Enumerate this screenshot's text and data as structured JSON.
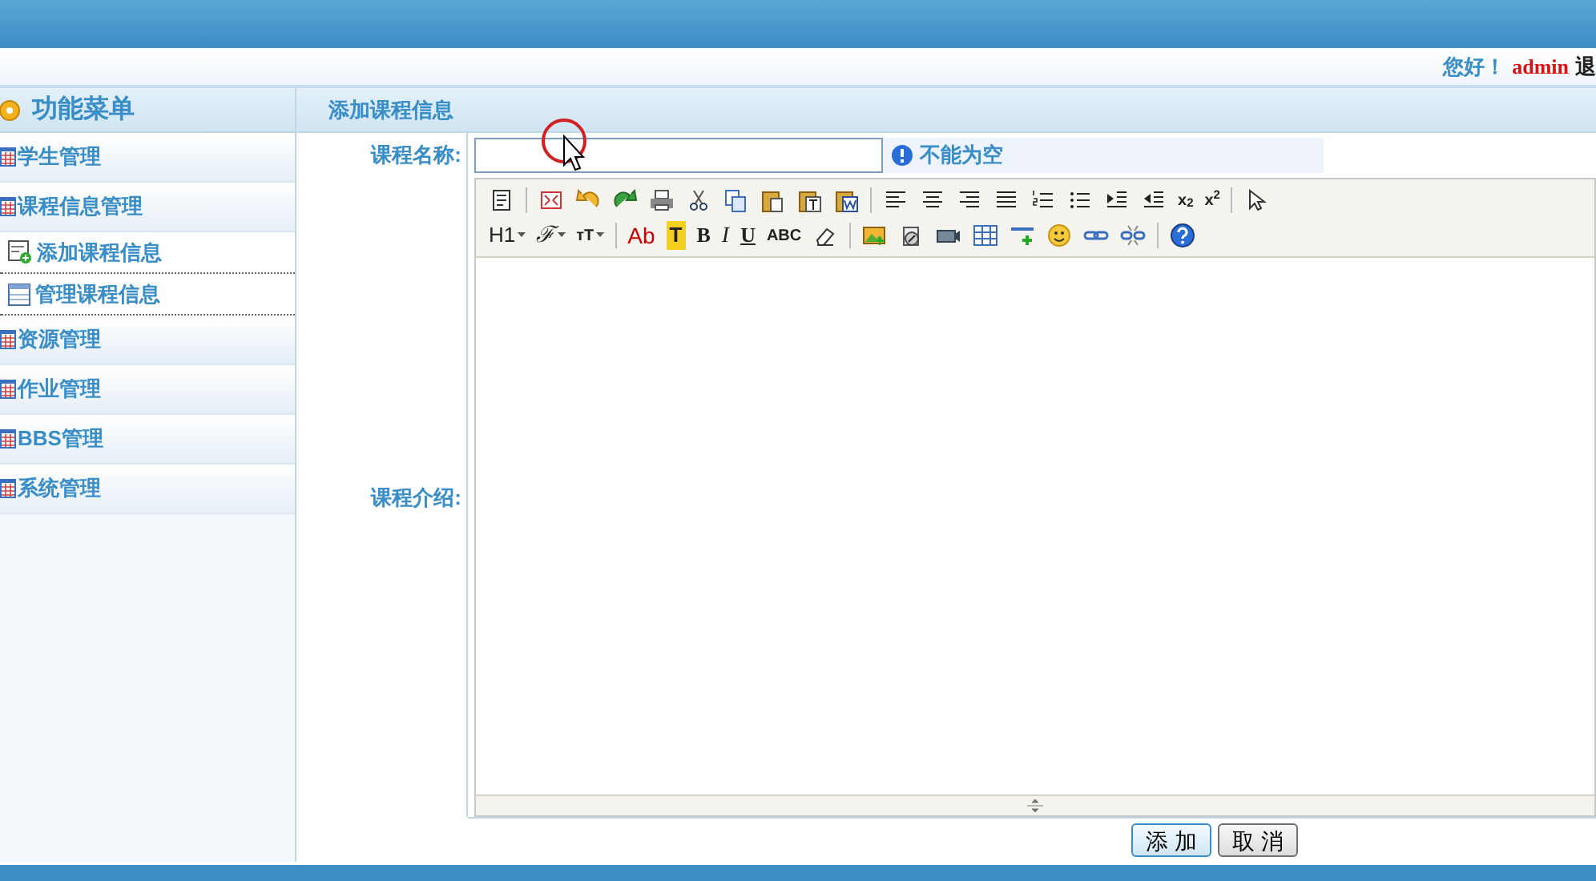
{
  "header": {
    "greeting": "您好！",
    "user": "admin",
    "logout": "退"
  },
  "menu": {
    "title": "功能菜单",
    "groups": [
      {
        "label": "学生管理"
      },
      {
        "label": "课程信息管理",
        "children": [
          {
            "label": "添加课程信息"
          },
          {
            "label": "管理课程信息"
          }
        ]
      },
      {
        "label": "资源管理"
      },
      {
        "label": "作业管理"
      },
      {
        "label": "BBS管理"
      },
      {
        "label": "系统管理"
      }
    ]
  },
  "panel_title": "添加课程信息",
  "form": {
    "name_label": "课程名称:",
    "name_hint": "不能为空",
    "intro_label": "课程介绍:"
  },
  "toolbar": [
    [
      {
        "kind": "icon"
      },
      {
        "kind": "sep"
      },
      {
        "kind": "icon"
      },
      {
        "kind": "icon"
      },
      {
        "kind": "icon"
      },
      {
        "kind": "icon"
      },
      {
        "kind": "icon"
      },
      {
        "kind": "icon"
      },
      {
        "kind": "icon"
      },
      {
        "kind": "icon"
      },
      {
        "kind": "icon"
      },
      {
        "kind": "sep"
      },
      {
        "kind": "icon"
      },
      {
        "kind": "icon"
      },
      {
        "kind": "icon"
      },
      {
        "kind": "icon"
      },
      {
        "kind": "icon"
      },
      {
        "kind": "icon"
      },
      {
        "kind": "icon"
      },
      {
        "kind": "icon"
      },
      {
        "kind": "small",
        "label": "x$_{2}$"
      },
      {
        "kind": "small",
        "label": "x$^{2}$"
      },
      {
        "kind": "sep"
      },
      {
        "kind": "icon"
      }
    ],
    [
      {
        "kind": "text",
        "label": "H1",
        "dropdown": true
      },
      {
        "kind": "italic",
        "label": "ℱ",
        "dropdown": true
      },
      {
        "kind": "small",
        "label": "тT",
        "dropdown": true
      },
      {
        "kind": "sep"
      },
      {
        "kind": "color",
        "label": "Ab",
        "color": "#cc0000"
      },
      {
        "kind": "highlight",
        "label": "T"
      },
      {
        "kind": "bold",
        "label": "B"
      },
      {
        "kind": "italic",
        "label": "I"
      },
      {
        "kind": "underline",
        "label": "U"
      },
      {
        "kind": "small",
        "label": "ABC"
      },
      {
        "kind": "icon"
      },
      {
        "kind": "sep"
      },
      {
        "kind": "icon"
      },
      {
        "kind": "icon"
      },
      {
        "kind": "icon"
      },
      {
        "kind": "icon"
      },
      {
        "kind": "icon"
      },
      {
        "kind": "icon"
      },
      {
        "kind": "icon"
      },
      {
        "kind": "icon"
      },
      {
        "kind": "sep"
      },
      {
        "kind": "icon"
      }
    ]
  ],
  "buttons": [
    {
      "label": "添 加",
      "selected": true
    },
    {
      "label": "取 消",
      "selected": false
    }
  ]
}
